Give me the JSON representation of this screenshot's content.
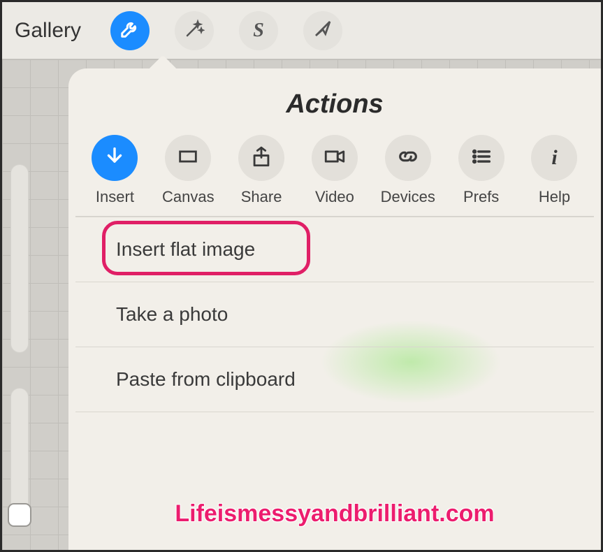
{
  "toolbar": {
    "gallery_label": "Gallery",
    "buttons": [
      {
        "name": "actions",
        "active": true
      },
      {
        "name": "adjustments",
        "active": false
      },
      {
        "name": "selection",
        "active": false
      },
      {
        "name": "transform",
        "active": false
      }
    ]
  },
  "popover": {
    "title": "Actions",
    "tabs": [
      {
        "name": "insert",
        "label": "Insert",
        "active": true
      },
      {
        "name": "canvas",
        "label": "Canvas",
        "active": false
      },
      {
        "name": "share",
        "label": "Share",
        "active": false
      },
      {
        "name": "video",
        "label": "Video",
        "active": false
      },
      {
        "name": "devices",
        "label": "Devices",
        "active": false
      },
      {
        "name": "prefs",
        "label": "Prefs",
        "active": false
      },
      {
        "name": "help",
        "label": "Help",
        "active": false
      }
    ],
    "menu": {
      "insert_flat_image": "Insert flat image",
      "take_a_photo": "Take a photo",
      "paste_from_clipboard": "Paste from clipboard"
    }
  },
  "watermark": "Lifeismessyandbrilliant.com"
}
